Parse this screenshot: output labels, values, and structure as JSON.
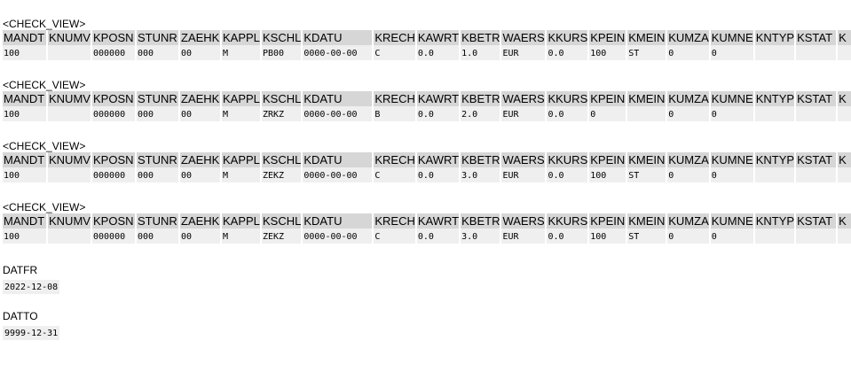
{
  "columns": [
    "MANDT",
    "KNUMV",
    "KPOSN",
    "STUNR",
    "ZAEHK",
    "KAPPL",
    "KSCHL",
    "KDATU",
    "KRECH",
    "KAWRT",
    "KBETR",
    "WAERS",
    "KKURS",
    "KPEIN",
    "KMEIN",
    "KUMZA",
    "KUMNE",
    "KNTYP",
    "KSTAT",
    "K"
  ],
  "blocks": [
    {
      "title": "<CHECK_VIEW>",
      "row": [
        "100",
        "",
        "000000",
        "000",
        "00",
        "M",
        "PB00",
        "0000-00-00",
        "C",
        "0.0",
        "1.0",
        "EUR",
        "0.0",
        "100",
        "ST",
        "0",
        "0",
        "",
        "",
        ""
      ]
    },
    {
      "title": "<CHECK_VIEW>",
      "row": [
        "100",
        "",
        "000000",
        "000",
        "00",
        "M",
        "ZRKZ",
        "0000-00-00",
        "B",
        "0.0",
        "2.0",
        "EUR",
        "0.0",
        "0",
        "",
        "0",
        "0",
        "",
        "",
        ""
      ]
    },
    {
      "title": "<CHECK_VIEW>",
      "row": [
        "100",
        "",
        "000000",
        "000",
        "00",
        "M",
        "ZEKZ",
        "0000-00-00",
        "C",
        "0.0",
        "3.0",
        "EUR",
        "0.0",
        "100",
        "ST",
        "0",
        "0",
        "",
        "",
        ""
      ]
    },
    {
      "title": "<CHECK_VIEW>",
      "row": [
        "100",
        "",
        "000000",
        "000",
        "00",
        "M",
        "ZEKZ",
        "0000-00-00",
        "C",
        "0.0",
        "3.0",
        "EUR",
        "0.0",
        "100",
        "ST",
        "0",
        "0",
        "",
        "",
        ""
      ]
    }
  ],
  "datfr": {
    "label": "DATFR",
    "value": "2022-12-08"
  },
  "datto": {
    "label": "DATTO",
    "value": "9999-12-31"
  }
}
